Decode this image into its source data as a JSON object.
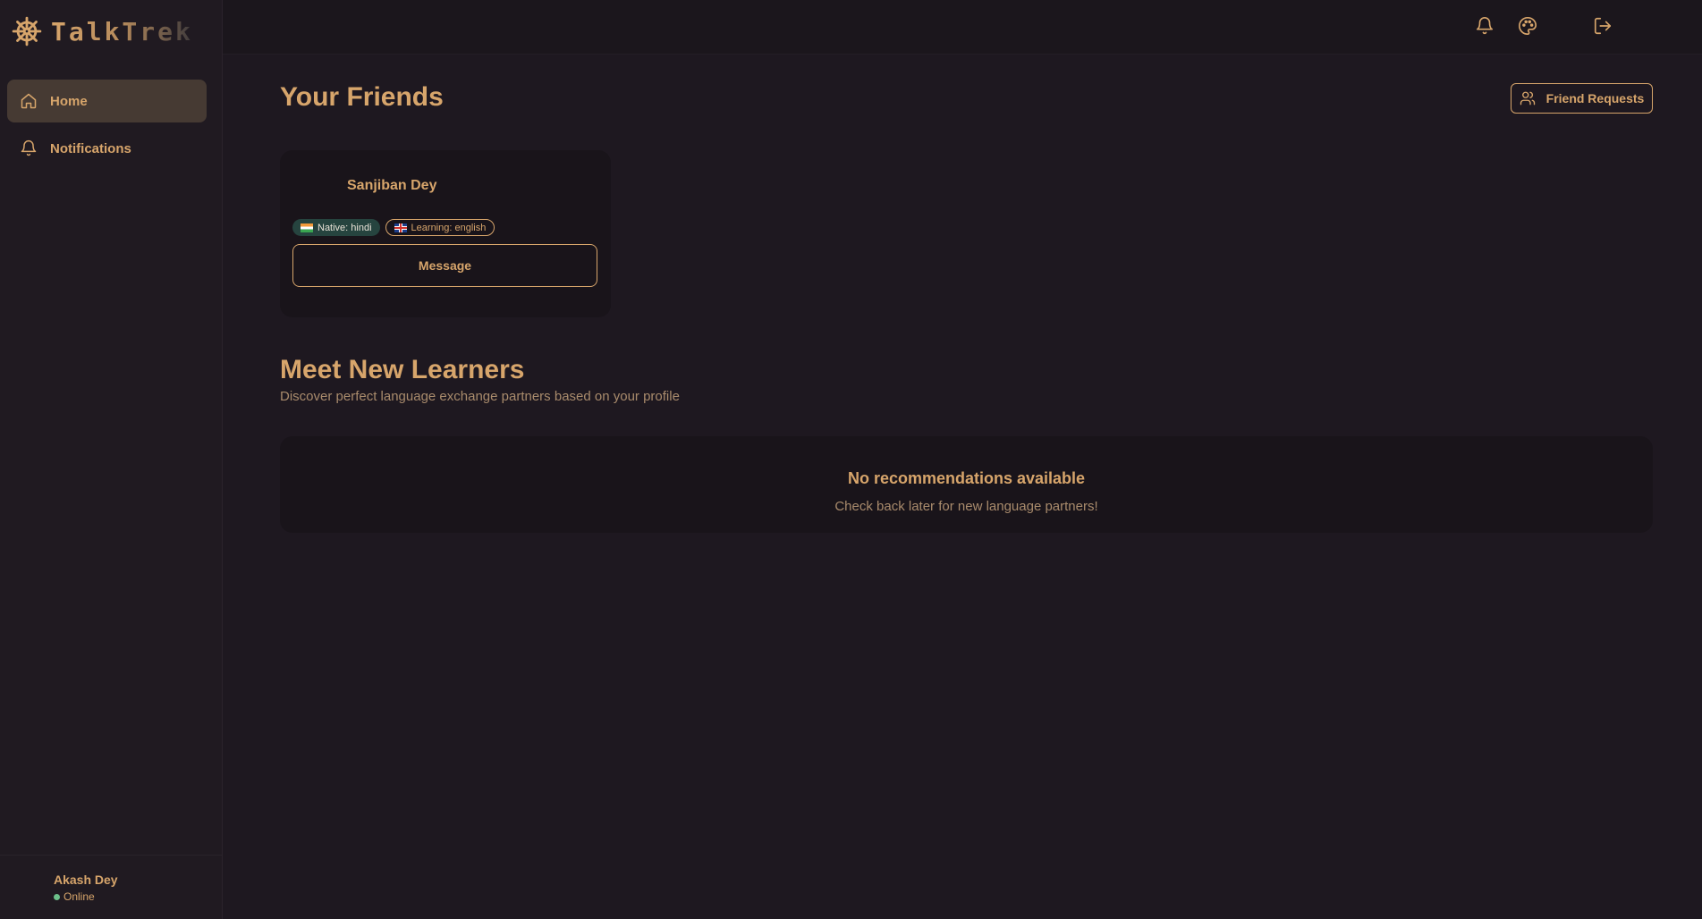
{
  "app": {
    "name": "TalkTrek",
    "logo_icon": "ship-wheel-icon"
  },
  "colors": {
    "accent": "#d7a56b",
    "background": "#1e1820",
    "sidebar": "#201a21",
    "active_nav": "#463a33",
    "native_badge": "#26443f",
    "online": "#6cc08a"
  },
  "sidebar": {
    "items": [
      {
        "label": "Home",
        "icon": "home-icon",
        "active": true
      },
      {
        "label": "Notifications",
        "icon": "bell-icon",
        "active": false
      }
    ],
    "user": {
      "name": "Akash Dey",
      "status": "Online"
    }
  },
  "topbar": {
    "icons": [
      "bell-icon",
      "palette-icon",
      "logout-icon"
    ]
  },
  "main": {
    "friends_title": "Your Friends",
    "friend_requests_label": "Friend Requests",
    "friends": [
      {
        "name": "Sanjiban Dey",
        "native": "Native: hindi",
        "learning": "Learning: english",
        "message_label": "Message"
      }
    ],
    "learners_title": "Meet New Learners",
    "learners_subtitle": "Discover perfect language exchange partners based on your profile",
    "empty_title": "No recommendations available",
    "empty_subtitle": "Check back later for new language partners!"
  }
}
